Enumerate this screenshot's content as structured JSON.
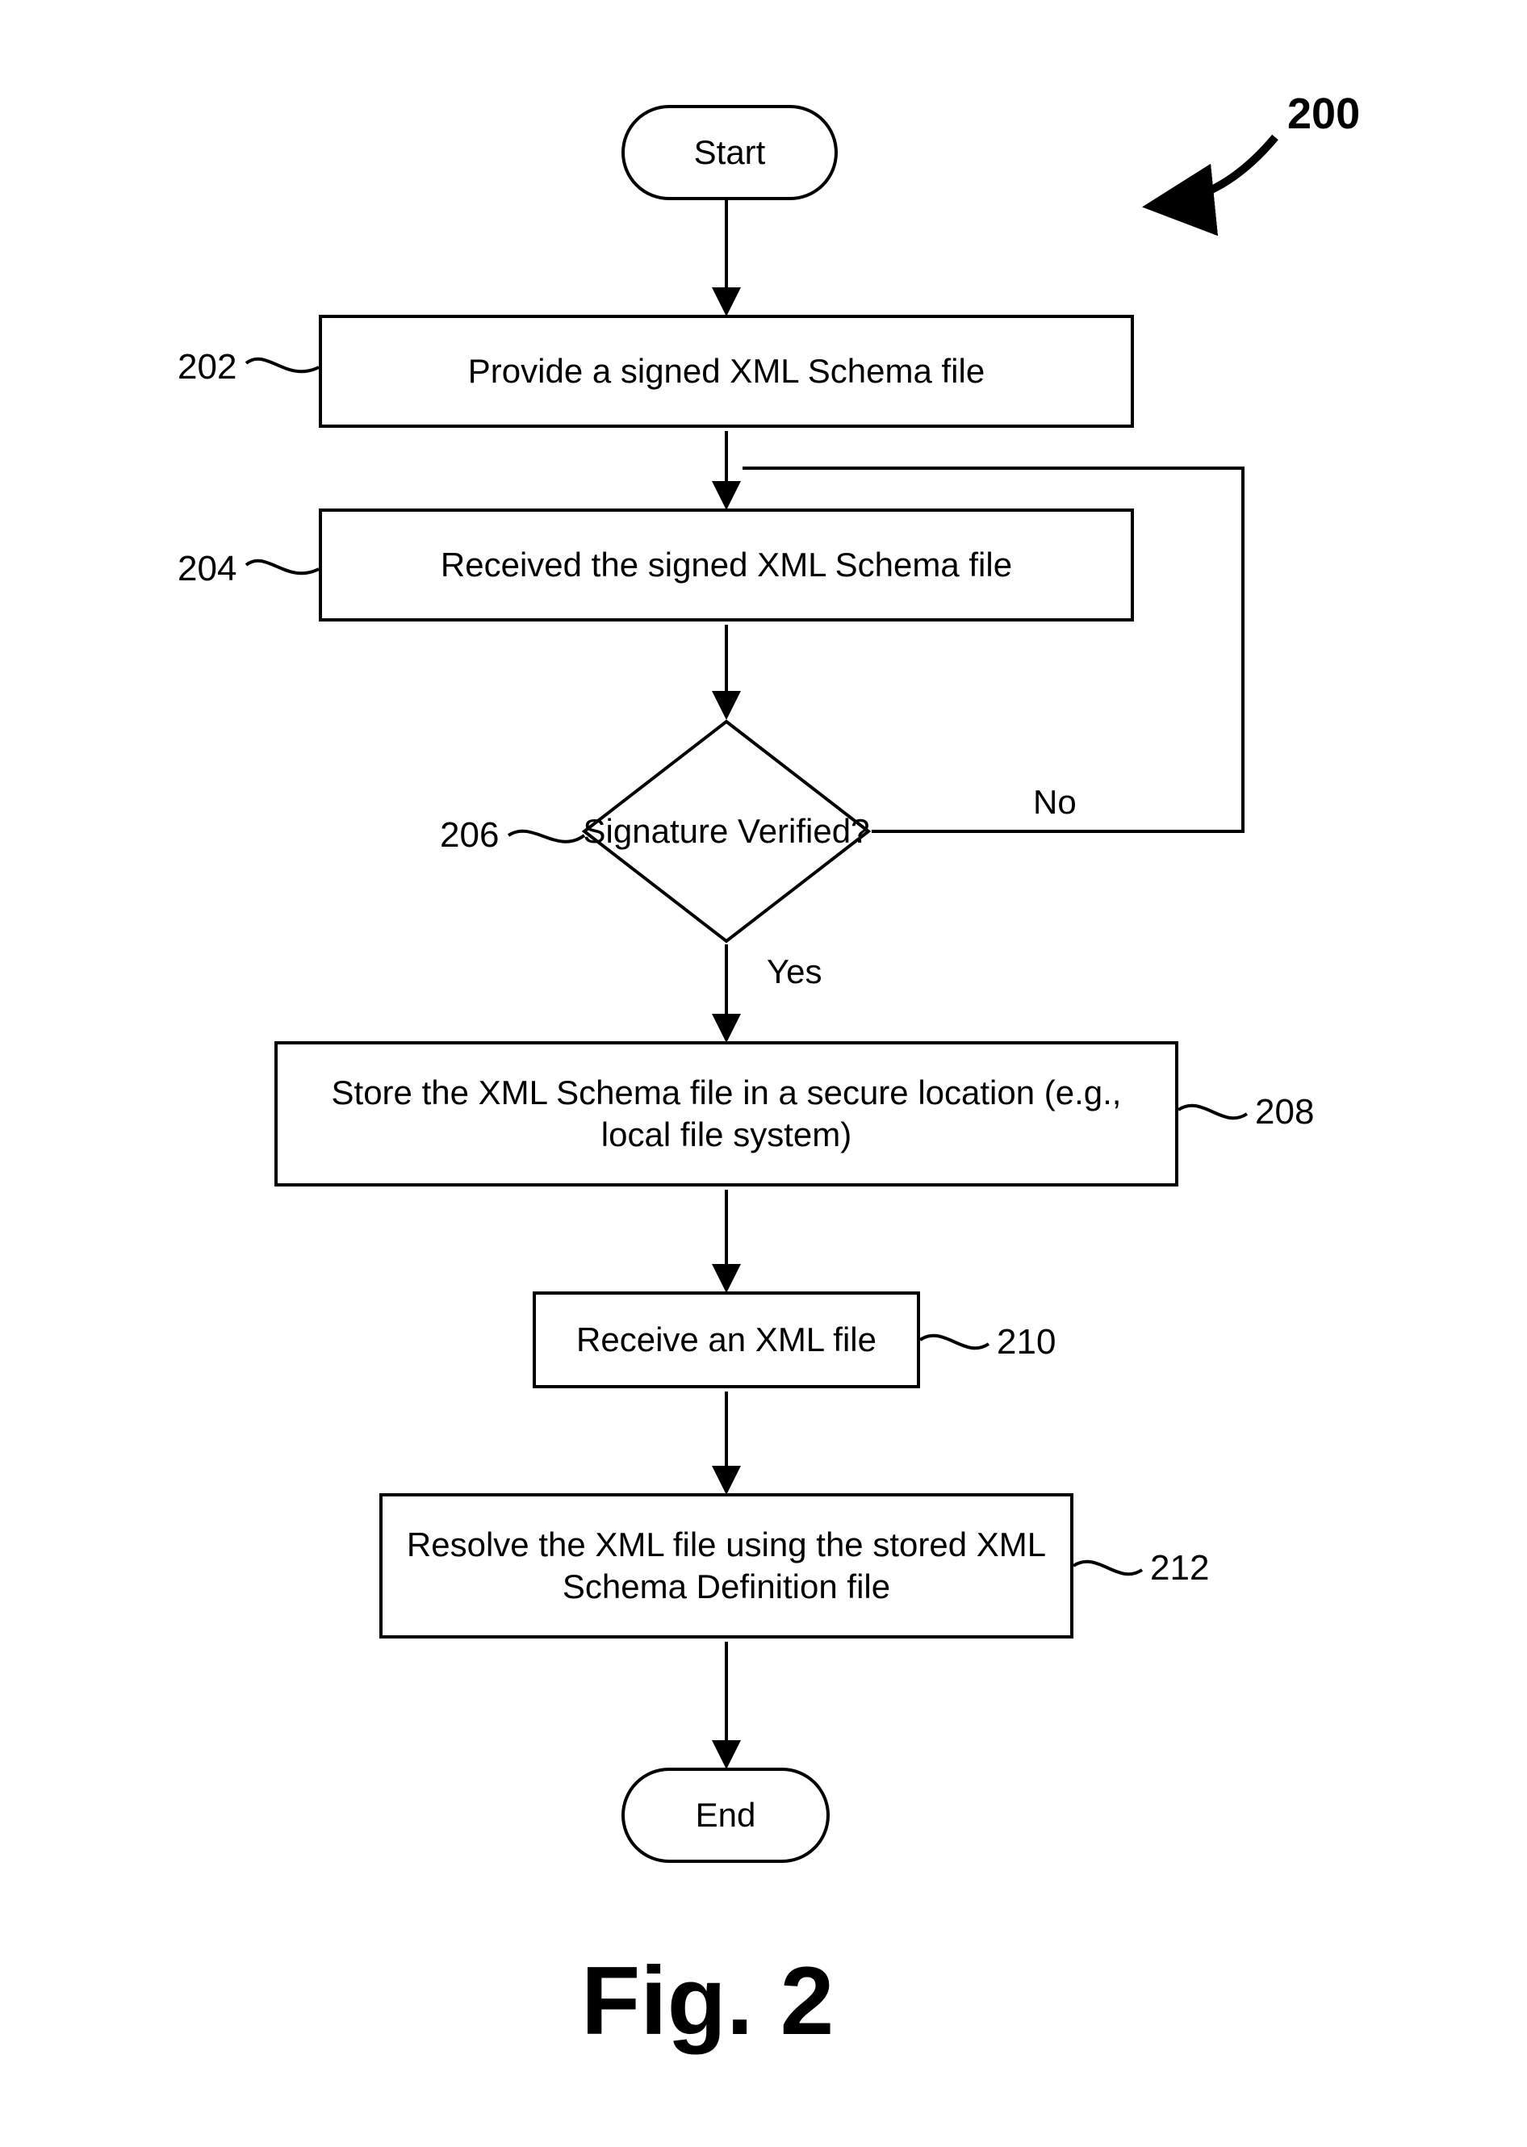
{
  "figure": {
    "caption": "Fig. 2",
    "ref_number": "200"
  },
  "nodes": {
    "start": "Start",
    "end": "End",
    "step202": "Provide a signed XML Schema  file",
    "step204": "Received the signed XML Schema file",
    "step206": "Signature Verified?",
    "step208": "Store the XML Schema file in a secure location (e.g., local file system)",
    "step210": "Receive an XML file",
    "step212": "Resolve the XML file using the stored XML Schema Definition file"
  },
  "refs": {
    "r202": "202",
    "r204": "204",
    "r206": "206",
    "r208": "208",
    "r210": "210",
    "r212": "212"
  },
  "edges": {
    "yes": "Yes",
    "no": "No"
  }
}
